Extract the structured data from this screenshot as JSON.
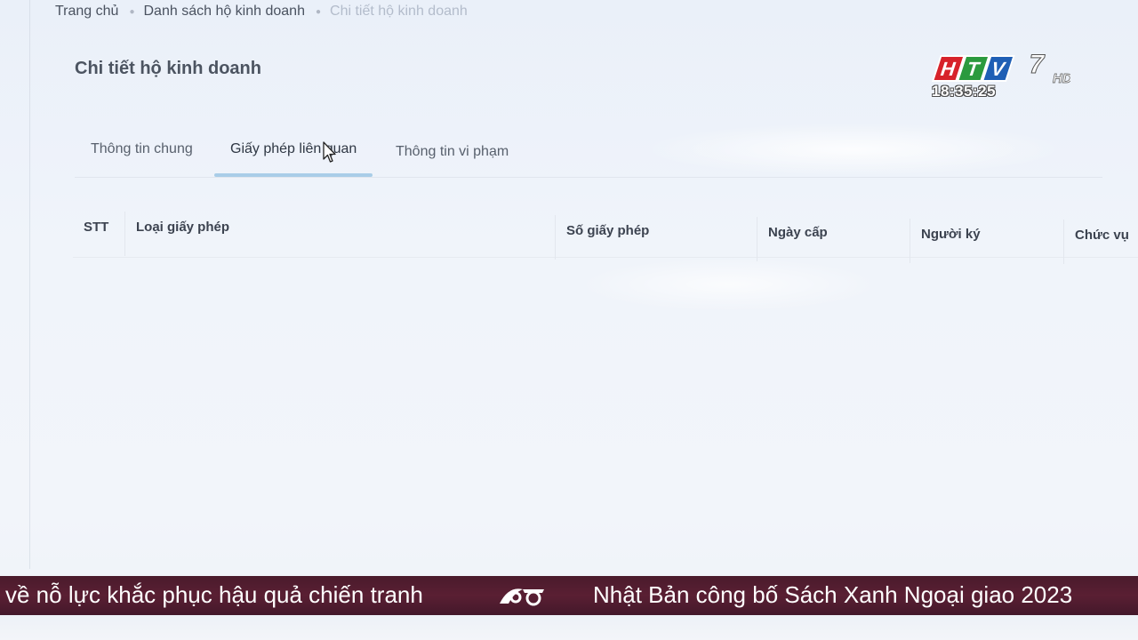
{
  "breadcrumb": {
    "home": "Trang chủ",
    "list": "Danh sách hộ kinh doanh",
    "current": "Chi tiết hộ kinh doanh"
  },
  "page_title": "Chi tiết hộ kinh doanh",
  "tabs": [
    {
      "label": "Thông tin chung",
      "active": false
    },
    {
      "label": "Giấy phép liên quan",
      "active": true
    },
    {
      "label": "Thông tin vi phạm",
      "active": false
    }
  ],
  "table": {
    "columns": [
      "STT",
      "Loại giấy phép",
      "Số giấy phép",
      "Ngày cấp",
      "Người ký",
      "Chức vụ"
    ],
    "rows": []
  },
  "overlay": {
    "channel_logo": "HTV7",
    "channel_logo_suffix": "HD",
    "clock": "18:35:25"
  },
  "ticker": {
    "left_text": "về nỗ lực khắc phục hậu quả chiến tranh",
    "right_text": "Nhật Bản công bố Sách Xanh Ngoại giao 2023"
  },
  "colors": {
    "background": "#eef2f8",
    "active_tab_indicator": "#a9cde8",
    "ticker_background": "#4a1b2c"
  }
}
